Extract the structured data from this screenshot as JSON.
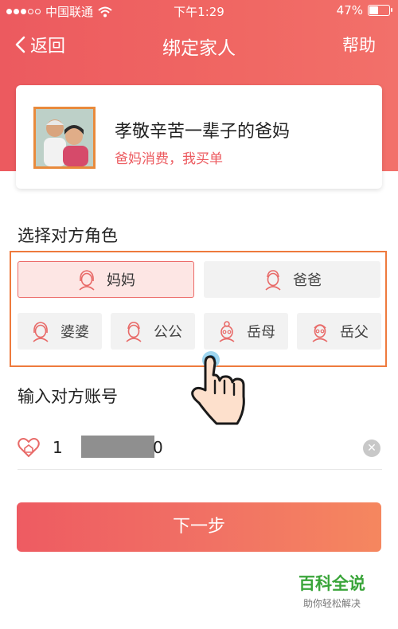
{
  "status_bar": {
    "carrier": "中国联通",
    "time": "下午1:29",
    "battery": "47%"
  },
  "nav": {
    "back_label": "返回",
    "title": "绑定家人",
    "help_label": "帮助"
  },
  "card": {
    "headline": "孝敬辛苦一辈子的爸妈",
    "subtext": "爸妈消费，我买单"
  },
  "role_section": {
    "title": "选择对方角色",
    "roles": [
      {
        "label": "妈妈",
        "icon": "woman-face-icon",
        "selected": true
      },
      {
        "label": "爸爸",
        "icon": "man-face-icon",
        "selected": false
      },
      {
        "label": "婆婆",
        "icon": "woman-face-icon",
        "selected": false
      },
      {
        "label": "公公",
        "icon": "man-face-icon",
        "selected": false
      },
      {
        "label": "岳母",
        "icon": "grandmother-face-icon",
        "selected": false
      },
      {
        "label": "岳父",
        "icon": "grandfather-face-icon",
        "selected": false
      }
    ]
  },
  "account_section": {
    "title": "输入对方账号",
    "value_prefix": "1",
    "value_suffix": "0"
  },
  "next_button": {
    "label": "下一步"
  },
  "watermark": {
    "title": "百科全说",
    "subtitle": "助你轻松解决"
  },
  "colors": {
    "brand": "#ec5a5f",
    "highlight_border": "#ee7a3d",
    "selected_bg": "#fde6e4"
  }
}
